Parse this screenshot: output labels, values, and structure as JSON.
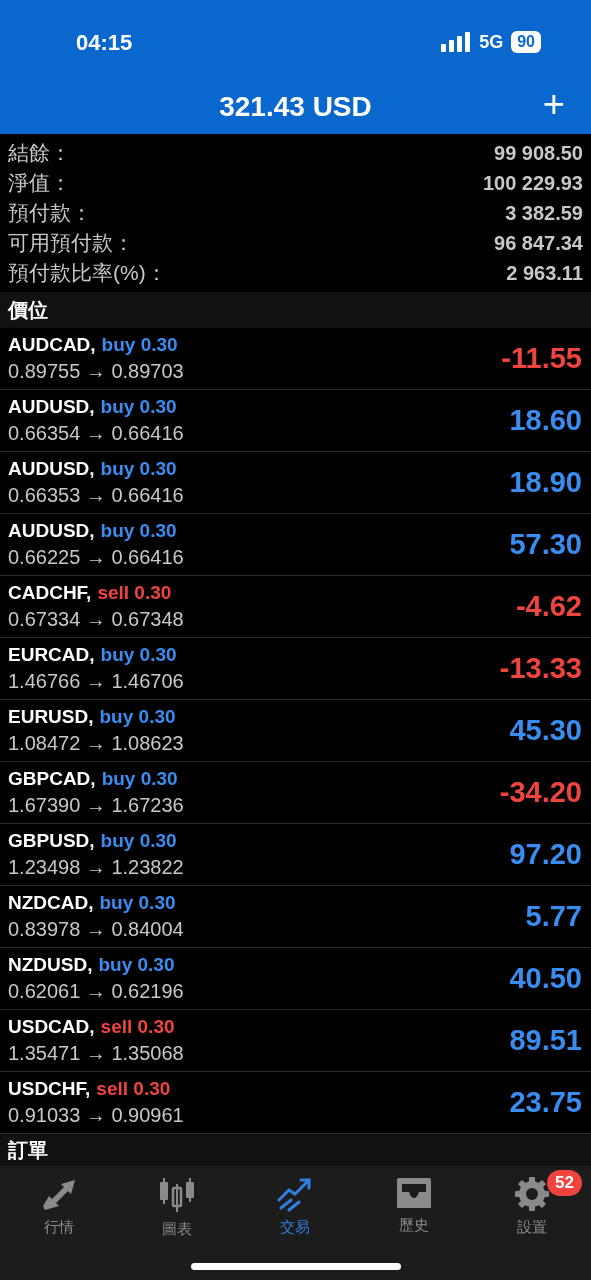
{
  "status_bar": {
    "time": "04:15",
    "network": "5G",
    "battery": "90"
  },
  "header": {
    "title": "321.43 USD",
    "add_button": "+"
  },
  "summary": [
    {
      "label": "結餘：",
      "value": "99 908.50"
    },
    {
      "label": "淨值：",
      "value": "100 229.93"
    },
    {
      "label": "預付款：",
      "value": "3 382.59"
    },
    {
      "label": "可用預付款：",
      "value": "96 847.34"
    },
    {
      "label": "預付款比率(%)：",
      "value": "2 963.11"
    }
  ],
  "positions_header": "價位",
  "positions": [
    {
      "symbol": "AUDCAD,",
      "order": "buy 0.30",
      "kind": "buy",
      "prices": "0.89755 → 0.89703",
      "profit": "-11.55",
      "loss": true
    },
    {
      "symbol": "AUDUSD,",
      "order": "buy 0.30",
      "kind": "buy",
      "prices": "0.66354 → 0.66416",
      "profit": "18.60",
      "loss": false
    },
    {
      "symbol": "AUDUSD,",
      "order": "buy 0.30",
      "kind": "buy",
      "prices": "0.66353 → 0.66416",
      "profit": "18.90",
      "loss": false
    },
    {
      "symbol": "AUDUSD,",
      "order": "buy 0.30",
      "kind": "buy",
      "prices": "0.66225 → 0.66416",
      "profit": "57.30",
      "loss": false
    },
    {
      "symbol": "CADCHF,",
      "order": "sell 0.30",
      "kind": "sell",
      "prices": "0.67334 → 0.67348",
      "profit": "-4.62",
      "loss": true
    },
    {
      "symbol": "EURCAD,",
      "order": "buy 0.30",
      "kind": "buy",
      "prices": "1.46766 → 1.46706",
      "profit": "-13.33",
      "loss": true
    },
    {
      "symbol": "EURUSD,",
      "order": "buy 0.30",
      "kind": "buy",
      "prices": "1.08472 → 1.08623",
      "profit": "45.30",
      "loss": false
    },
    {
      "symbol": "GBPCAD,",
      "order": "buy 0.30",
      "kind": "buy",
      "prices": "1.67390 → 1.67236",
      "profit": "-34.20",
      "loss": true
    },
    {
      "symbol": "GBPUSD,",
      "order": "buy 0.30",
      "kind": "buy",
      "prices": "1.23498 → 1.23822",
      "profit": "97.20",
      "loss": false
    },
    {
      "symbol": "NZDCAD,",
      "order": "buy 0.30",
      "kind": "buy",
      "prices": "0.83978 → 0.84004",
      "profit": "5.77",
      "loss": false
    },
    {
      "symbol": "NZDUSD,",
      "order": "buy 0.30",
      "kind": "buy",
      "prices": "0.62061 → 0.62196",
      "profit": "40.50",
      "loss": false
    },
    {
      "symbol": "USDCAD,",
      "order": "sell 0.30",
      "kind": "sell",
      "prices": "1.35471 → 1.35068",
      "profit": "89.51",
      "loss": false
    },
    {
      "symbol": "USDCHF,",
      "order": "sell 0.30",
      "kind": "sell",
      "prices": "0.91033 → 0.90961",
      "profit": "23.75",
      "loss": false
    }
  ],
  "orders_header": "訂單",
  "tab_bar": [
    {
      "label": "行情",
      "kind": "quotes",
      "selected": false
    },
    {
      "label": "圖表",
      "kind": "chart",
      "selected": false
    },
    {
      "label": "交易",
      "kind": "trade",
      "selected": true
    },
    {
      "label": "歷史",
      "kind": "history",
      "selected": false
    },
    {
      "label": "設置",
      "kind": "settings",
      "selected": false,
      "badge": "52"
    }
  ]
}
